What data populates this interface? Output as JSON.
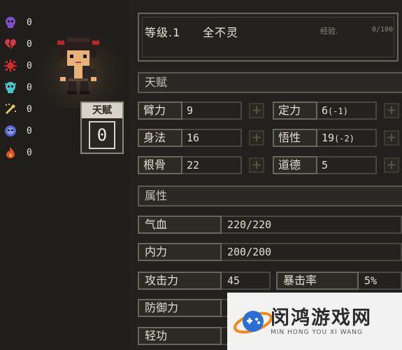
{
  "status_counters": [
    {
      "icon": "purple-skull-icon",
      "value": "0",
      "color": "#8a5ad6"
    },
    {
      "icon": "broken-heart-icon",
      "value": "0",
      "color": "#d63a4a"
    },
    {
      "icon": "red-virus-icon",
      "value": "0",
      "color": "#e03030"
    },
    {
      "icon": "cyan-skull-icon",
      "value": "0",
      "color": "#4fd0d6"
    },
    {
      "icon": "bone-sparkle-icon",
      "value": "0",
      "color": "#e0c060"
    },
    {
      "icon": "blue-mask-icon",
      "value": "0",
      "color": "#5a6ad6"
    },
    {
      "icon": "fire-icon",
      "value": "0",
      "color": "#e05a30"
    }
  ],
  "talent_card": {
    "title": "天赋",
    "value": "0"
  },
  "header": {
    "level": "等级.1",
    "name": "全不灵",
    "exp_label": "经验.",
    "exp_value": "0/100"
  },
  "sections": {
    "talent": "天赋",
    "attributes": "属性"
  },
  "talent_stats": [
    {
      "label": "臂力",
      "value": "9",
      "mod": ""
    },
    {
      "label": "定力",
      "value": "6",
      "mod": "(-1)"
    },
    {
      "label": "身法",
      "value": "16",
      "mod": ""
    },
    {
      "label": "悟性",
      "value": "19",
      "mod": "(-2)"
    },
    {
      "label": "根骨",
      "value": "22",
      "mod": ""
    },
    {
      "label": "道德",
      "value": "5",
      "mod": ""
    }
  ],
  "plus_symbol": "+",
  "properties": {
    "qixue": {
      "label": "气血",
      "value": "220/220"
    },
    "neili": {
      "label": "内力",
      "value": "200/200"
    },
    "gongji": {
      "label": "攻击力",
      "value": "45"
    },
    "baoji": {
      "label": "暴击率",
      "value": "5%"
    },
    "fangyu": {
      "label": "防御力",
      "value": ""
    },
    "qinggong": {
      "label": "轻功",
      "value": ""
    }
  },
  "watermark": {
    "title": "闵鸿游戏网",
    "subtitle": "MIN HONG YOU XI WANG"
  }
}
